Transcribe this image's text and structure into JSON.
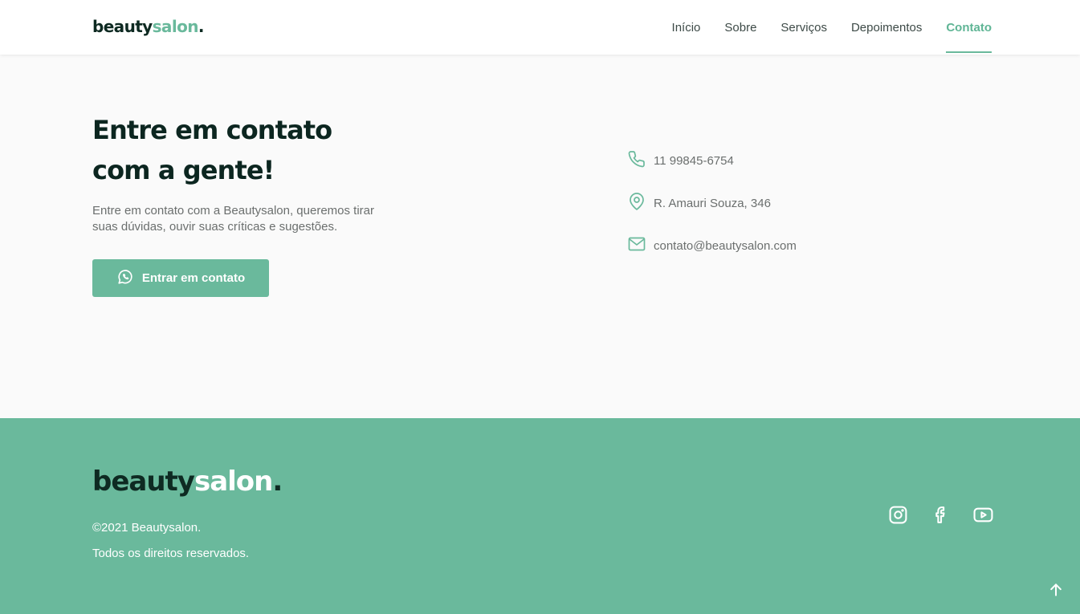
{
  "brand": {
    "part1": "beauty",
    "part2": "salon",
    "dot": "."
  },
  "nav": {
    "items": [
      {
        "label": "Início"
      },
      {
        "label": "Sobre"
      },
      {
        "label": "Serviços"
      },
      {
        "label": "Depoimentos"
      },
      {
        "label": "Contato",
        "active": true
      }
    ]
  },
  "hero": {
    "title_line1": "Entre em contato",
    "title_line2": "com a gente!",
    "description": "Entre em contato com a Beautysalon, queremos tirar suas dúvidas, ouvir suas críticas e sugestões.",
    "cta_label": "Entrar em contato",
    "cta_icon": "whatsapp-icon"
  },
  "contact": {
    "phone": "11 99845-6754",
    "address": "R. Amauri Souza, 346",
    "email": "contato@beautysalon.com"
  },
  "footer": {
    "copyright": "©2021 Beautysalon.",
    "rights": "Todos os direitos reservados.",
    "socials": [
      "instagram-icon",
      "facebook-icon",
      "youtube-icon"
    ]
  },
  "colors": {
    "accent": "#6ab99c",
    "dark": "#0e2a22",
    "text_muted": "#6b6f6e",
    "background": "#fafafa"
  }
}
